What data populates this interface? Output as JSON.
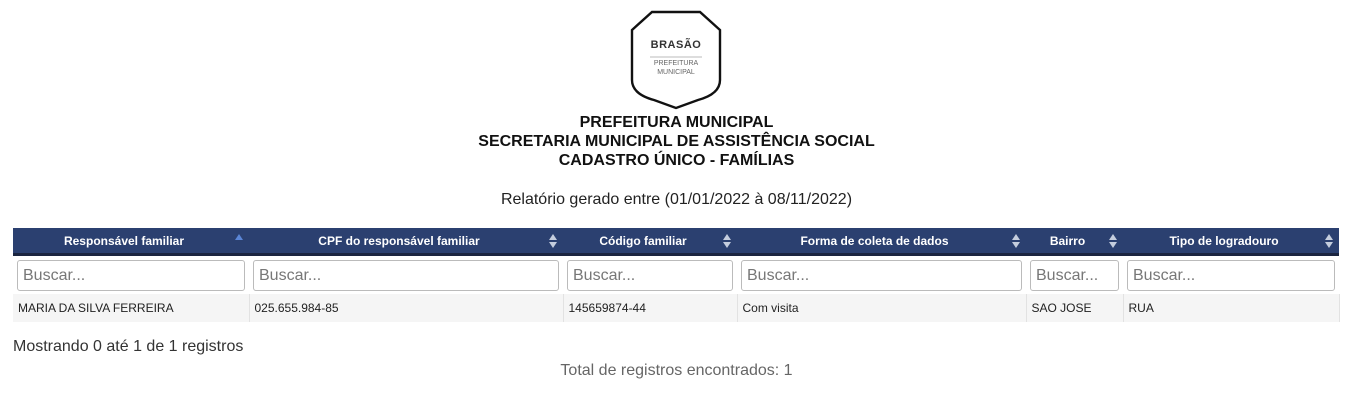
{
  "crest": {
    "title": "BRASÃO",
    "sub1": "PREFEITURA",
    "sub2": "MUNICIPAL"
  },
  "header": {
    "line1": "PREFEITURA MUNICIPAL",
    "line2": "SECRETARIA MUNICIPAL DE ASSISTÊNCIA SOCIAL",
    "line3": "CADASTRO ÚNICO - FAMÍLIAS",
    "period": "Relatório gerado entre (01/01/2022 à 08/11/2022)"
  },
  "table": {
    "columns": [
      {
        "label": "Responsável familiar",
        "sort": "asc"
      },
      {
        "label": "CPF do responsável familiar",
        "sort": "none"
      },
      {
        "label": "Código familiar",
        "sort": "none"
      },
      {
        "label": "Forma de coleta de dados",
        "sort": "none"
      },
      {
        "label": "Bairro",
        "sort": "none"
      },
      {
        "label": "Tipo de logradouro",
        "sort": "none"
      }
    ],
    "search_placeholder": "Buscar...",
    "rows": [
      [
        "MARIA DA SILVA FERREIRA",
        "025.655.984-85",
        "145659874-44",
        "Com visita",
        "SAO JOSE",
        "RUA"
      ]
    ]
  },
  "footer": {
    "info": "Mostrando 0 até 1 de 1 registros",
    "total": "Total de registros encontrados: 1"
  },
  "colors": {
    "header_bg": "#2b4070",
    "row_bg": "#f5f5f5",
    "sort_active": "#5b86d6",
    "sort_idle": "#c5cede"
  }
}
